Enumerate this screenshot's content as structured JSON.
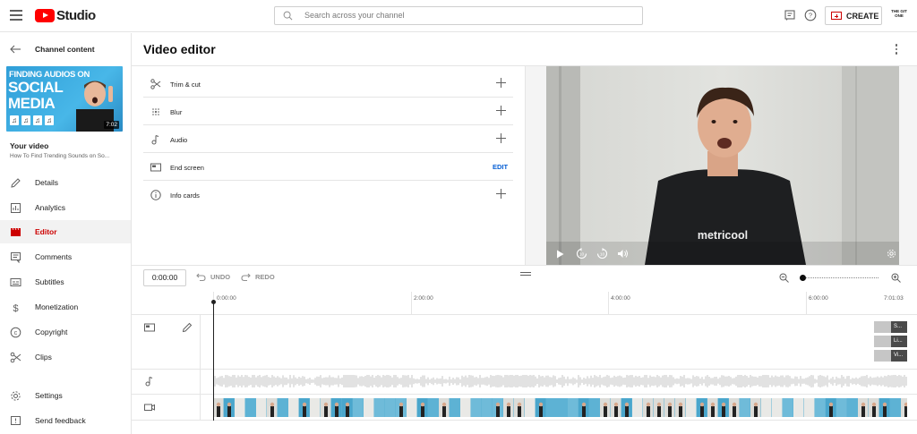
{
  "topbar": {
    "logo_text": "Studio",
    "search_placeholder": "Search across your channel",
    "create_label": "CREATE",
    "avatar_text": "THE GIT ONE"
  },
  "sidebar": {
    "back_label": "Channel content",
    "thumbnail": {
      "line1": "FINDING AUDIOS ON",
      "line2": "SOCIAL",
      "line3": "MEDIA",
      "duration": "7:02"
    },
    "your_video_label": "Your video",
    "video_title": "How To Find Trending Sounds on So...",
    "items": [
      {
        "label": "Details",
        "icon": "pencil-icon"
      },
      {
        "label": "Analytics",
        "icon": "analytics-icon"
      },
      {
        "label": "Editor",
        "icon": "editor-icon",
        "active": true
      },
      {
        "label": "Comments",
        "icon": "comments-icon"
      },
      {
        "label": "Subtitles",
        "icon": "subtitles-icon"
      },
      {
        "label": "Monetization",
        "icon": "dollar-icon"
      },
      {
        "label": "Copyright",
        "icon": "copyright-icon"
      },
      {
        "label": "Clips",
        "icon": "scissors-icon"
      },
      {
        "label": "Settings",
        "icon": "gear-icon"
      },
      {
        "label": "Send feedback",
        "icon": "feedback-icon"
      }
    ]
  },
  "main": {
    "title": "Video editor",
    "options": [
      {
        "label": "Trim & cut",
        "icon": "scissors-icon",
        "action": "+"
      },
      {
        "label": "Blur",
        "icon": "blur-icon",
        "action": "+"
      },
      {
        "label": "Audio",
        "icon": "music-note-icon",
        "action": "+"
      },
      {
        "label": "End screen",
        "icon": "end-screen-icon",
        "action": "EDIT"
      },
      {
        "label": "Info cards",
        "icon": "info-icon",
        "action": "+"
      }
    ],
    "preview": {
      "shirt_text": "metricool"
    }
  },
  "timeline": {
    "timecode": "0:00:00",
    "undo_label": "UNDO",
    "redo_label": "REDO",
    "ticks": [
      "0:00:00",
      "2:00:00",
      "4:00:00",
      "6:00:00",
      "7:01:03"
    ],
    "end_screen_elements": [
      "S...",
      "Li...",
      "Vi..."
    ],
    "zoom_level": 0.0
  },
  "colors": {
    "accent_red": "#cc0000",
    "link_blue": "#065fd4",
    "thumbnail_blue": "#2f9ed8"
  }
}
